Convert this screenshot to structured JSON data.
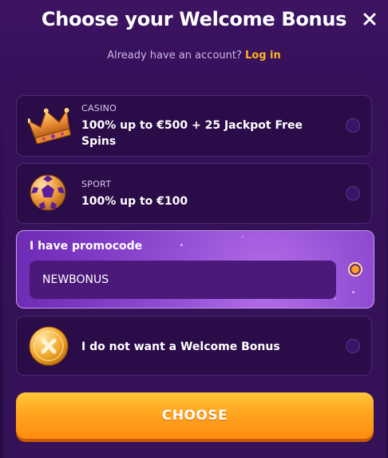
{
  "header": {
    "title": "Choose your Welcome Bonus",
    "subtitle": "Already have an account?",
    "login_link": "Log in"
  },
  "options": [
    {
      "icon": "crown-icon",
      "category": "CASINO",
      "description": "100% up to €500 + 25 Jackpot Free Spins",
      "selected": false
    },
    {
      "icon": "soccer-ball-icon",
      "category": "SPORT",
      "description": "100% up to €100",
      "selected": false
    }
  ],
  "promo": {
    "label": "I have promocode",
    "value": "NEWBONUS",
    "selected": true
  },
  "no_bonus": {
    "icon": "no-bonus-coin-icon",
    "label": "I do not want a Welcome Bonus",
    "selected": false
  },
  "cta": {
    "label": "CHOOSE"
  },
  "colors": {
    "accent_orange": "#ff9e2a",
    "login_link": "#ffb41f",
    "promo_bg": "#9550d6",
    "background": "#2a0f46"
  }
}
